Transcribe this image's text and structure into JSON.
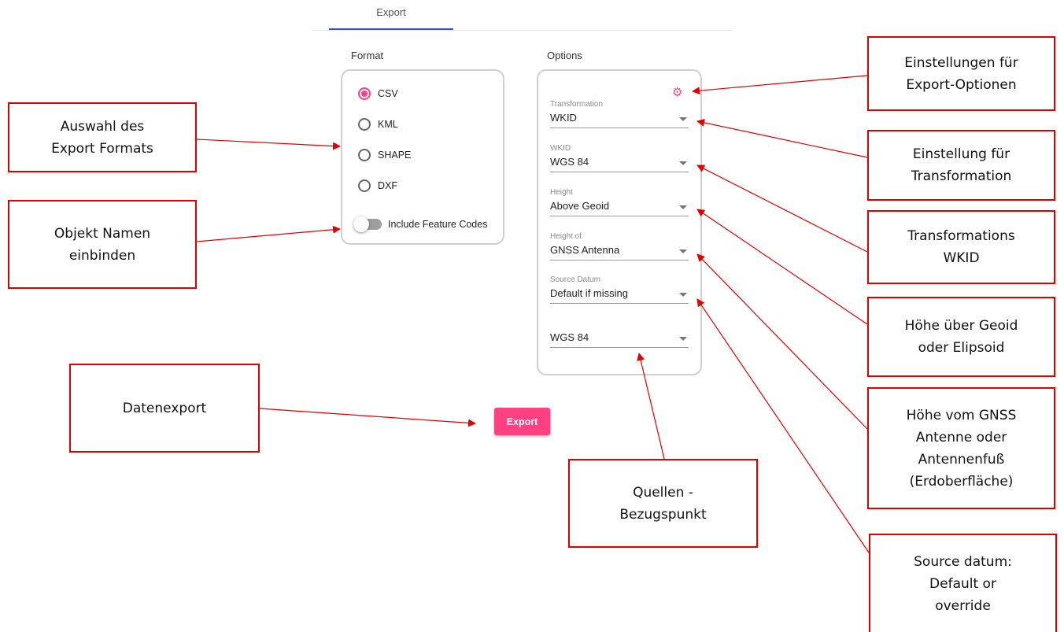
{
  "tab": {
    "label": "Export"
  },
  "format": {
    "title": "Format",
    "options": [
      {
        "label": "CSV",
        "checked": true
      },
      {
        "label": "KML",
        "checked": false
      },
      {
        "label": "SHAPE",
        "checked": false
      },
      {
        "label": "DXF",
        "checked": false
      }
    ],
    "toggle_label": "Include Feature Codes",
    "toggle_on": false
  },
  "options": {
    "title": "Options",
    "settings_icon": "gear-icon",
    "fields": [
      {
        "label": "Transformation",
        "value": "WKID"
      },
      {
        "label": "WKID",
        "value": "WGS 84"
      },
      {
        "label": "Height",
        "value": "Above Geoid"
      },
      {
        "label": "Height of",
        "value": "GNSS Antenna"
      },
      {
        "label": "Source Datum",
        "value": "Default if missing"
      },
      {
        "label": "",
        "value": "WGS 84"
      }
    ]
  },
  "export_button": "Export",
  "annotations": {
    "export_options": "Einstellungen für\nExport-Optionen",
    "format_select": "Auswahl des\nExport Formats",
    "transformation": "Einstellung für\nTransformation",
    "object_names": "Objekt Namen\neinbinden",
    "wkid": "Transformations\nWKID",
    "height": "Höhe über Geoid\noder Elipsoid",
    "data_export": "Datenexport",
    "height_of": "Höhe vom GNSS\nAntenne oder\nAntennenfuß\n(Erdoberfläche)",
    "source_ref": "Quellen -\nBezugspunkt",
    "source_datum": "Source datum:\nDefault or\noverride"
  },
  "colors": {
    "accent": "#ff4081",
    "tab_indicator": "#3f51b5",
    "annotation": "#e00000"
  }
}
